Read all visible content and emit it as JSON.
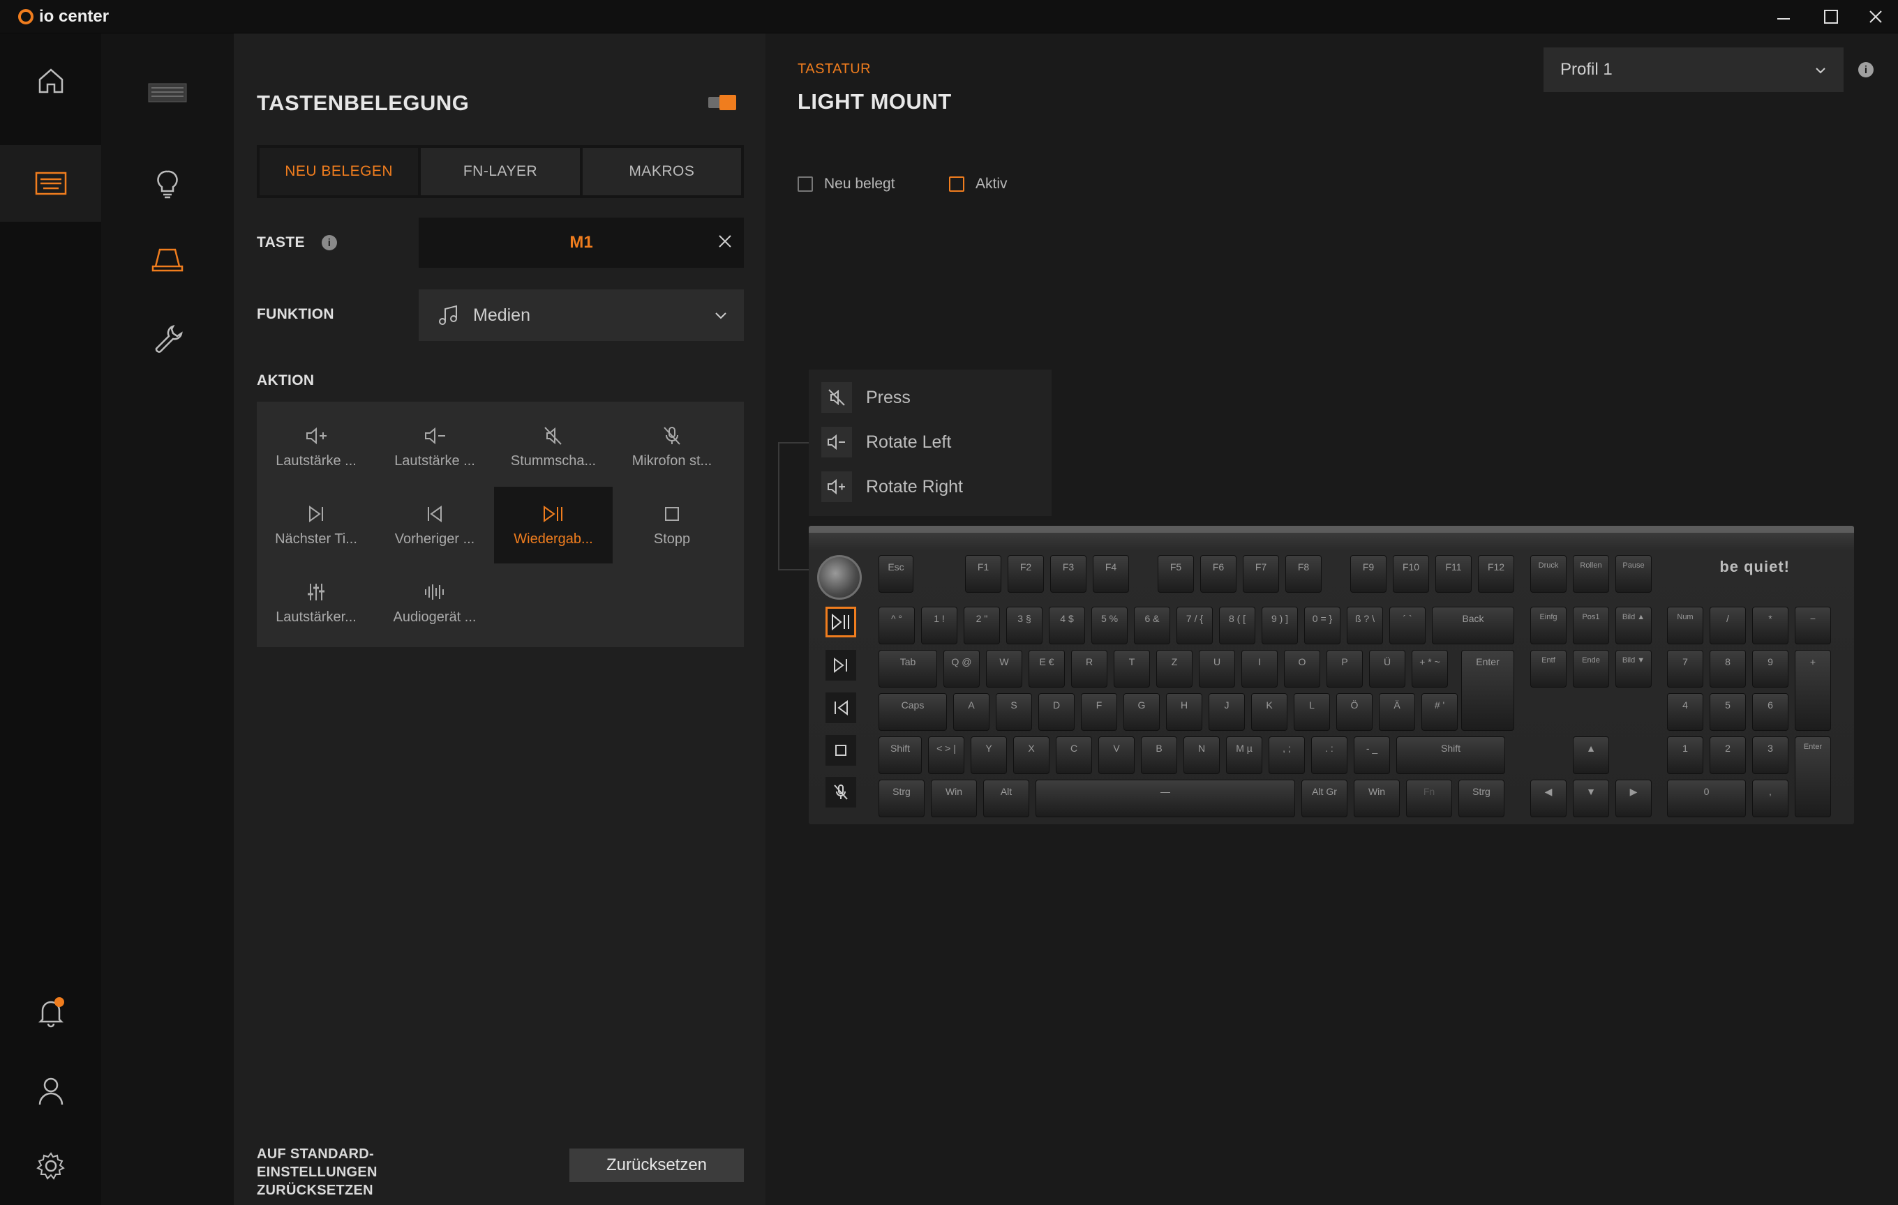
{
  "app": {
    "name": "io center",
    "window_controls": {
      "minimize": "—",
      "maximize": "☐",
      "close": "✕"
    }
  },
  "rail_primary": [
    {
      "id": "home",
      "icon": "home-icon"
    },
    {
      "id": "keyboard",
      "icon": "keyboard-icon",
      "active": true
    },
    {
      "id": "notifications",
      "icon": "bell-icon",
      "has_notification": true
    },
    {
      "id": "account",
      "icon": "user-icon"
    },
    {
      "id": "settings",
      "icon": "gear-icon"
    }
  ],
  "rail_secondary": [
    {
      "id": "device",
      "icon": "keyboard-thumbnail-icon"
    },
    {
      "id": "lighting",
      "icon": "lightbulb-icon"
    },
    {
      "id": "keymapping",
      "icon": "keycap-icon",
      "active": true
    },
    {
      "id": "tools",
      "icon": "wrench-icon"
    }
  ],
  "panel": {
    "title": "TASTENBELEGUNG",
    "tabs": [
      {
        "label": "NEU BELEGEN",
        "active": true
      },
      {
        "label": "FN-LAYER",
        "active": false
      },
      {
        "label": "MAKROS",
        "active": false
      }
    ],
    "key_label": "TASTE",
    "key_value": "M1",
    "function_label": "FUNKTION",
    "function_value": "Medien",
    "action_label": "AKTION",
    "actions": [
      {
        "label": "Lautstärke ...",
        "icon": "volume-up-icon"
      },
      {
        "label": "Lautstärke ...",
        "icon": "volume-down-icon"
      },
      {
        "label": "Stummscha...",
        "icon": "mute-icon"
      },
      {
        "label": "Mikrofon st...",
        "icon": "mic-mute-icon"
      },
      {
        "label": "Nächster Ti...",
        "icon": "next-track-icon"
      },
      {
        "label": "Vorheriger ...",
        "icon": "previous-track-icon"
      },
      {
        "label": "Wiedergab...",
        "icon": "play-pause-icon",
        "active": true
      },
      {
        "label": "Stopp",
        "icon": "stop-icon"
      },
      {
        "label": "Lautstärker...",
        "icon": "mixer-icon"
      },
      {
        "label": "Audiogerät ...",
        "icon": "audio-device-icon"
      }
    ],
    "reset_text": "AUF STANDARD-EINSTELLUNGEN ZURÜCKSETZEN",
    "reset_button": "Zurücksetzen"
  },
  "main": {
    "section": "TASTATUR",
    "device_name": "LIGHT MOUNT",
    "profile": "Profil 1",
    "legend": [
      {
        "label": "Neu belegt",
        "color": "#777777"
      },
      {
        "label": "Aktiv",
        "color": "#f07d1e"
      }
    ],
    "knob_menu": [
      {
        "label": "Press",
        "icon": "mute-icon"
      },
      {
        "label": "Rotate Left",
        "icon": "volume-down-icon"
      },
      {
        "label": "Rotate Right",
        "icon": "volume-up-icon"
      }
    ],
    "keyboard": {
      "brand": "be quiet!",
      "macro_keys": [
        "play-pause-icon",
        "next-track-icon",
        "previous-track-icon",
        "stop-icon",
        "mic-mute-icon"
      ],
      "keys": {
        "esc": "Esc",
        "f": [
          "F1",
          "F2",
          "F3",
          "F4",
          "F5",
          "F6",
          "F7",
          "F8",
          "F9",
          "F10",
          "F11",
          "F12"
        ],
        "nav_top": [
          "Druck",
          "Rollen",
          "Pause"
        ],
        "num_row": [
          "^ °",
          "1 !",
          "2 \"",
          "3 §",
          "4 $",
          "5 %",
          "6 &",
          "7 / {",
          "8 ( [",
          "9 ) ]",
          "0 = }",
          "ß ? \\",
          "´ `"
        ],
        "back": "Back",
        "nav1": [
          "Einfg",
          "Pos1",
          "Bild ▲"
        ],
        "numpad1": [
          "Num",
          "/",
          "*",
          "−"
        ],
        "tab": "Tab",
        "q_row": [
          "Q @",
          "W",
          "E €",
          "R",
          "T",
          "Z",
          "U",
          "I",
          "O",
          "P",
          "Ü",
          "+ * ~"
        ],
        "enter": "Enter",
        "nav2": [
          "Entf",
          "Ende",
          "Bild ▼"
        ],
        "numpad2": [
          "7",
          "8",
          "9",
          "+"
        ],
        "caps": "Caps",
        "a_row": [
          "A",
          "S",
          "D",
          "F",
          "G",
          "H",
          "J",
          "K",
          "L",
          "Ö",
          "Ä",
          "# '"
        ],
        "numpad3": [
          "4",
          "5",
          "6"
        ],
        "shift_l": "Shift",
        "y_row": [
          "< > |",
          "Y",
          "X",
          "C",
          "V",
          "B",
          "N",
          "M µ",
          ", ;",
          ". :",
          "- _"
        ],
        "shift_r": "Shift",
        "up": "▲",
        "numpad4": [
          "1",
          "2",
          "3",
          "Enter"
        ],
        "bottom": [
          "Strg",
          "Win",
          "Alt"
        ],
        "space": "—",
        "bottom_r": [
          "Alt Gr",
          "Win",
          "Fn",
          "Strg"
        ],
        "arrows": [
          "◀",
          "▼",
          "▶"
        ],
        "numpad5": [
          "0",
          ","
        ]
      }
    }
  }
}
